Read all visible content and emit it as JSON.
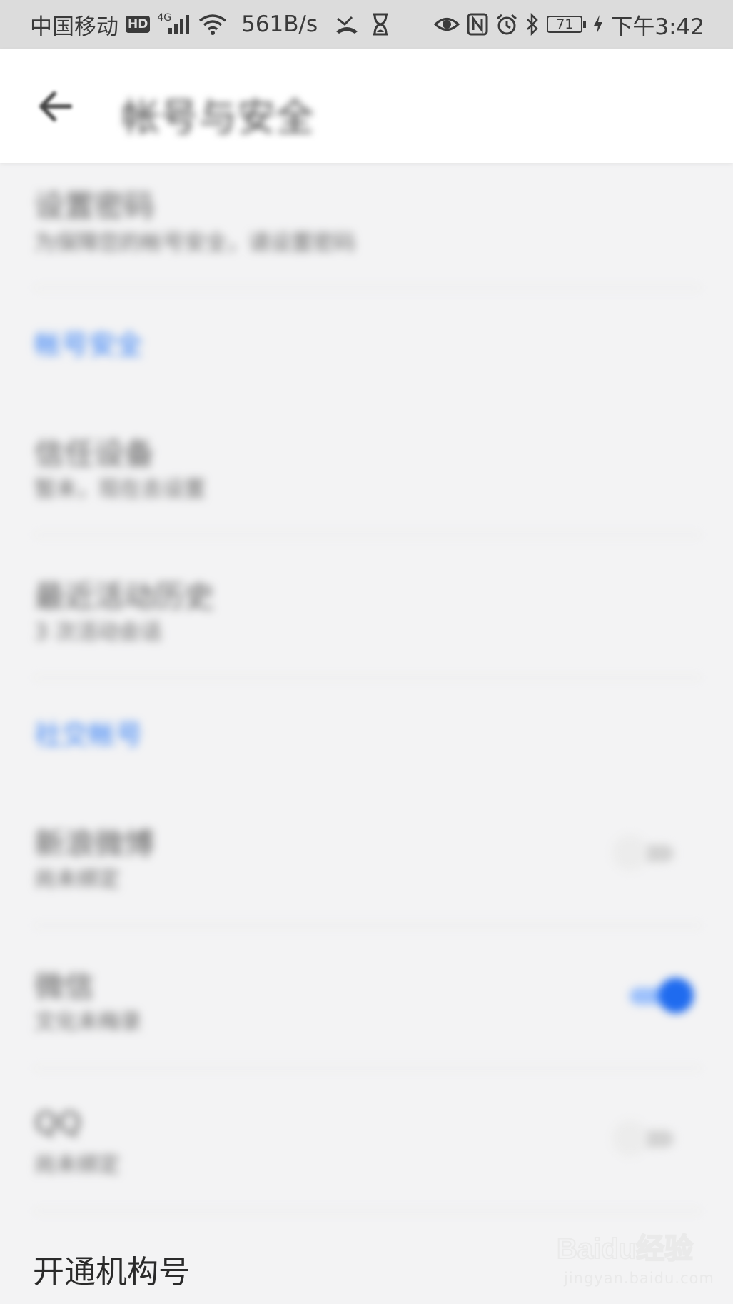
{
  "status_bar": {
    "carrier": "中国移动",
    "hd_badge": "HD",
    "network_type": "4G",
    "speed": "561B/s",
    "battery_level": "71",
    "time": "下午3:42",
    "icons": [
      "hd-icon",
      "signal-icon",
      "wifi-icon",
      "missed-call-icon",
      "hourglass-icon",
      "eye-icon",
      "nfc-icon",
      "alarm-icon",
      "bluetooth-icon",
      "battery-icon",
      "charging-icon"
    ]
  },
  "app_bar": {
    "title": "帐号与安全",
    "back_icon": "back-arrow-icon"
  },
  "list": {
    "set_password": {
      "title": "设置密码",
      "subtitle": "为保障您的帐号安全，请设置密码"
    },
    "section_account_security": "帐号安全",
    "trusted_devices": {
      "title": "信任设备",
      "subtitle": "暂未，现在去设置"
    },
    "recent_activity": {
      "title": "最近活动历史",
      "subtitle": "3 次活动会话"
    },
    "section_social": "社交帐号",
    "weibo": {
      "title": "新浪微博",
      "subtitle": "尚未绑定",
      "enabled": false
    },
    "wechat": {
      "title": "微信",
      "subtitle": "文化未梅录",
      "enabled": true
    },
    "qq": {
      "title": "QQ",
      "subtitle": "尚未绑定",
      "enabled": false
    },
    "org_account": {
      "title": "开通机构号"
    }
  },
  "watermark": {
    "logo": "Baidu经验",
    "url": "jingyan.baidu.com"
  },
  "colors": {
    "accent": "#1f6bef",
    "section_header": "#2f7cf6",
    "background": "#f3f3f4",
    "status_bar": "#dcdcdc"
  }
}
